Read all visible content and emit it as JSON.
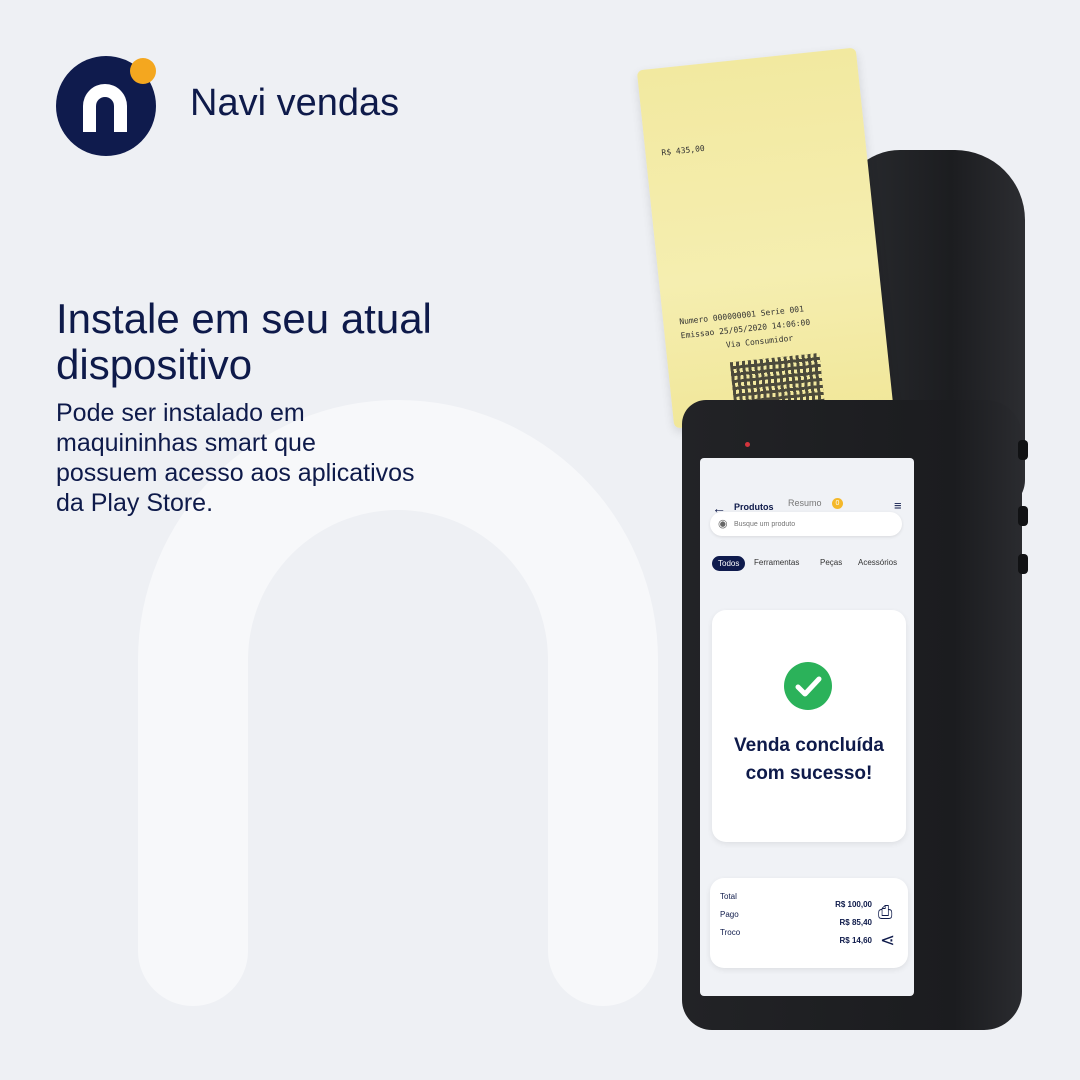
{
  "brand": {
    "name": "Navi vendas"
  },
  "hero": {
    "headline": "Instale em seu atual dispositivo",
    "body": "Pode ser instalado em maquininhas smart que possuem acesso aos aplicativos da Play Store."
  },
  "receipt": {
    "numero": "Numero 000000001  Serie 001",
    "emissao": "Emissao  25/05/2020  14:06:00",
    "via": "Via Consumidor",
    "total_items": "R$ 435,00"
  },
  "screen": {
    "tabs": {
      "produtos": "Produtos",
      "resumo": "Resumo",
      "resumo_badge": "0"
    },
    "search": {
      "placeholder": "Busque um produto"
    },
    "categories": {
      "todos": "Todos",
      "ferramentas": "Ferramentas",
      "pecas": "Peças",
      "acessorios": "Acessórios"
    },
    "success": {
      "message": "Venda concluída com sucesso!"
    },
    "totals": {
      "total_label": "Total",
      "total_value": "R$ 100,00",
      "pago_label": "Pago",
      "pago_value": "R$ 85,40",
      "troco_label": "Troco",
      "troco_value": "R$ 14,60"
    }
  },
  "colors": {
    "navy": "#0f1b4d",
    "accent": "#f4a71f",
    "success": "#2bb25a",
    "paper": "#f5eeb0"
  }
}
